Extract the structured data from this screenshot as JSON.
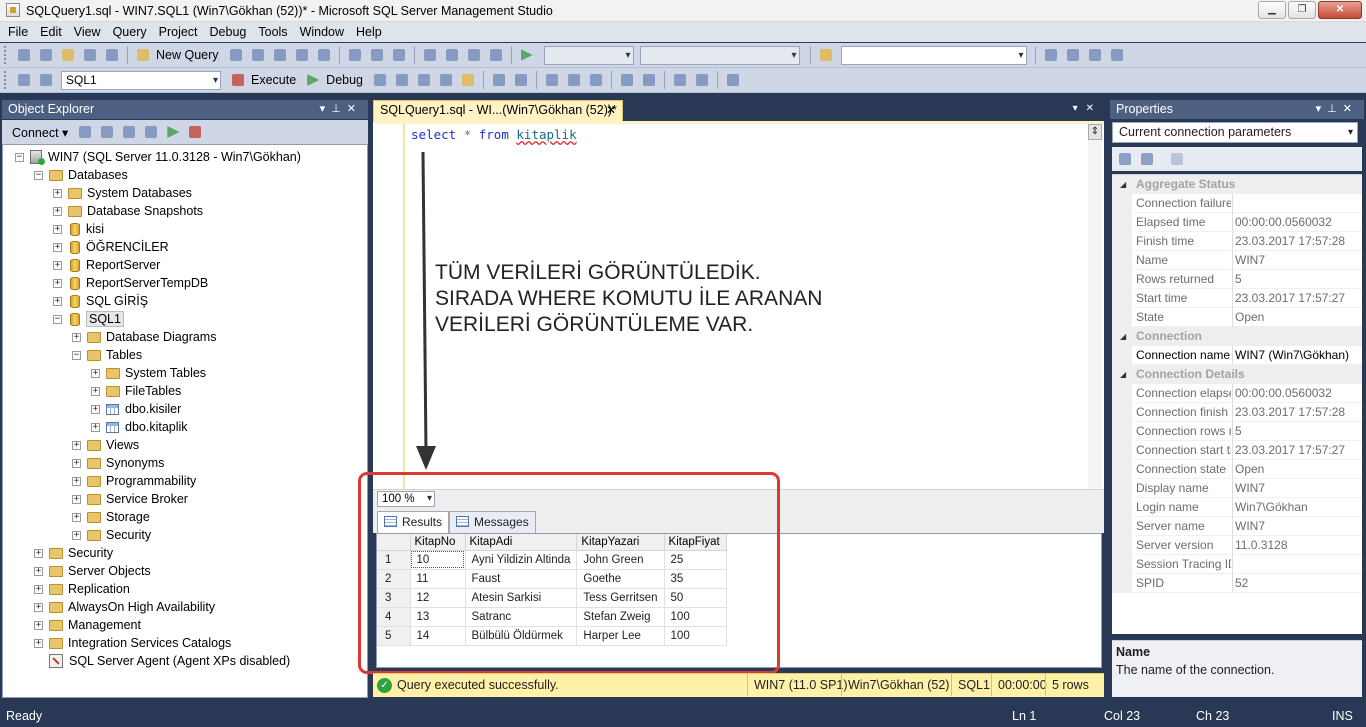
{
  "window": {
    "title": "SQLQuery1.sql - WIN7.SQL1 (Win7\\Gökhan (52))* - Microsoft SQL Server Management Studio",
    "min_glyph": "▁",
    "max_glyph": "❐",
    "close_glyph": "✕"
  },
  "menu": [
    "File",
    "Edit",
    "View",
    "Query",
    "Project",
    "Debug",
    "Tools",
    "Window",
    "Help"
  ],
  "toolbar": {
    "new_query_label": "New Query",
    "database_value": "SQL1",
    "execute_label": "Execute",
    "debug_label": "Debug"
  },
  "object_explorer": {
    "title": "Object Explorer",
    "connect_label": "Connect ▾",
    "tree": [
      {
        "label": "WIN7 (SQL Server 11.0.3128 - Win7\\Gökhan)",
        "exp": "−"
      },
      {
        "label": "Databases",
        "exp": "−"
      },
      {
        "label": "System Databases",
        "exp": "+"
      },
      {
        "label": "Database Snapshots",
        "exp": "+"
      },
      {
        "label": "kisi",
        "exp": "+"
      },
      {
        "label": "ÖĞRENCİLER",
        "exp": "+"
      },
      {
        "label": "ReportServer",
        "exp": "+"
      },
      {
        "label": "ReportServerTempDB",
        "exp": "+"
      },
      {
        "label": "SQL GİRİŞ",
        "exp": "+"
      },
      {
        "label": "SQL1",
        "exp": "−"
      },
      {
        "label": "Database Diagrams",
        "exp": "+"
      },
      {
        "label": "Tables",
        "exp": "−"
      },
      {
        "label": "System Tables",
        "exp": "+"
      },
      {
        "label": "FileTables",
        "exp": "+"
      },
      {
        "label": "dbo.kisiler",
        "exp": "+"
      },
      {
        "label": "dbo.kitaplik",
        "exp": "+"
      },
      {
        "label": "Views",
        "exp": "+"
      },
      {
        "label": "Synonyms",
        "exp": "+"
      },
      {
        "label": "Programmability",
        "exp": "+"
      },
      {
        "label": "Service Broker",
        "exp": "+"
      },
      {
        "label": "Storage",
        "exp": "+"
      },
      {
        "label": "Security",
        "exp": "+"
      },
      {
        "label": "Security",
        "exp": "+"
      },
      {
        "label": "Server Objects",
        "exp": "+"
      },
      {
        "label": "Replication",
        "exp": "+"
      },
      {
        "label": "AlwaysOn High Availability",
        "exp": "+"
      },
      {
        "label": "Management",
        "exp": "+"
      },
      {
        "label": "Integration Services Catalogs",
        "exp": "+"
      },
      {
        "label": "SQL Server Agent (Agent XPs disabled)",
        "exp": ""
      }
    ]
  },
  "editor": {
    "tab_label": "SQLQuery1.sql - WI...(Win7\\Gökhan (52))*",
    "tab_close": "✕",
    "query": {
      "kw1": "select",
      "star": "*",
      "kw2": "from",
      "table": "kitaplik"
    },
    "annotation": [
      "TÜM VERİLERİ GÖRÜNTÜLEDİK.",
      "SIRADA WHERE KOMUTU İLE ARANAN",
      "VERİLERİ GÖRÜNTÜLEME VAR."
    ],
    "zoom": "100 %"
  },
  "results": {
    "tabs": [
      "Results",
      "Messages"
    ],
    "columns": [
      "KitapNo",
      "KitapAdi",
      "KitapYazari",
      "KitapFiyat"
    ],
    "rows": [
      [
        "1",
        "10",
        "Ayni Yildizin Altinda",
        "John Green",
        "25"
      ],
      [
        "2",
        "11",
        "Faust",
        "Goethe",
        "35"
      ],
      [
        "3",
        "12",
        "Atesin Sarkisi",
        "Tess Gerritsen",
        "50"
      ],
      [
        "4",
        "13",
        "Satranc",
        "Stefan Zweig",
        "100"
      ],
      [
        "5",
        "14",
        "Bülbülü Öldürmek",
        "Harper Lee",
        "100"
      ]
    ]
  },
  "query_status": {
    "message": "Query executed successfully.",
    "server": "WIN7 (11.0 SP1)",
    "user": "Win7\\Gökhan (52)",
    "database": "SQL1",
    "elapsed": "00:00:00",
    "rows": "5 rows"
  },
  "properties": {
    "title": "Properties",
    "object": "Current connection parameters",
    "rows": [
      {
        "name": "Aggregate Status",
        "value": "",
        "cat": true
      },
      {
        "name": "Connection failures",
        "value": ""
      },
      {
        "name": "Elapsed time",
        "value": "00:00:00.0560032"
      },
      {
        "name": "Finish time",
        "value": "23.03.2017 17:57:28"
      },
      {
        "name": "Name",
        "value": "WIN7"
      },
      {
        "name": "Rows returned",
        "value": "5"
      },
      {
        "name": "Start time",
        "value": "23.03.2017 17:57:27"
      },
      {
        "name": "State",
        "value": "Open"
      },
      {
        "name": "Connection",
        "value": "",
        "cat": true
      },
      {
        "name": "Connection name",
        "value": "WIN7 (Win7\\Gökhan)",
        "dark": true
      },
      {
        "name": "Connection Details",
        "value": "",
        "cat": true
      },
      {
        "name": "Connection elapsed time",
        "value": "00:00:00.0560032"
      },
      {
        "name": "Connection finish time",
        "value": "23.03.2017 17:57:28"
      },
      {
        "name": "Connection rows returned",
        "value": "5"
      },
      {
        "name": "Connection start time",
        "value": "23.03.2017 17:57:27"
      },
      {
        "name": "Connection state",
        "value": "Open"
      },
      {
        "name": "Display name",
        "value": "WIN7"
      },
      {
        "name": "Login name",
        "value": "Win7\\Gökhan"
      },
      {
        "name": "Server name",
        "value": "WIN7"
      },
      {
        "name": "Server version",
        "value": "11.0.3128"
      },
      {
        "name": "Session Tracing ID",
        "value": ""
      },
      {
        "name": "SPID",
        "value": "52"
      }
    ],
    "desc_title": "Name",
    "desc_text": "The name of the connection."
  },
  "statusbar": {
    "ready": "Ready",
    "ln": "Ln 1",
    "col": "Col 23",
    "ch": "Ch 23",
    "ins": "INS"
  },
  "colors": {
    "chrome": "#293955",
    "panel_header": "#4d6082",
    "active_tab": "#fff3c4",
    "highlight_box": "#d93a33",
    "status_ok": "#fff1a8"
  }
}
